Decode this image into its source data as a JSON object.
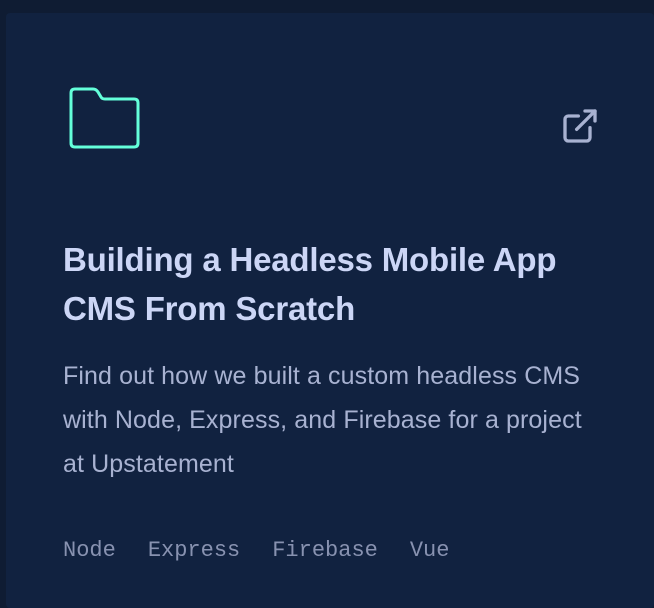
{
  "card": {
    "title": "Building a Headless Mobile App CMS From Scratch",
    "description": "Find out how we built a custom headless CMS with Node, Express, and Firebase for a project at Upstatement",
    "tech": [
      "Node",
      "Express",
      "Firebase",
      "Vue"
    ],
    "icons": {
      "folder": "folder-icon",
      "external": "external-link-icon"
    }
  },
  "colors": {
    "page_background": "#0f1c33",
    "card_background": "#112240",
    "accent": "#64ffda",
    "title": "#ccd6f6",
    "text": "#a8b2d1",
    "tech": "#8892b0"
  }
}
